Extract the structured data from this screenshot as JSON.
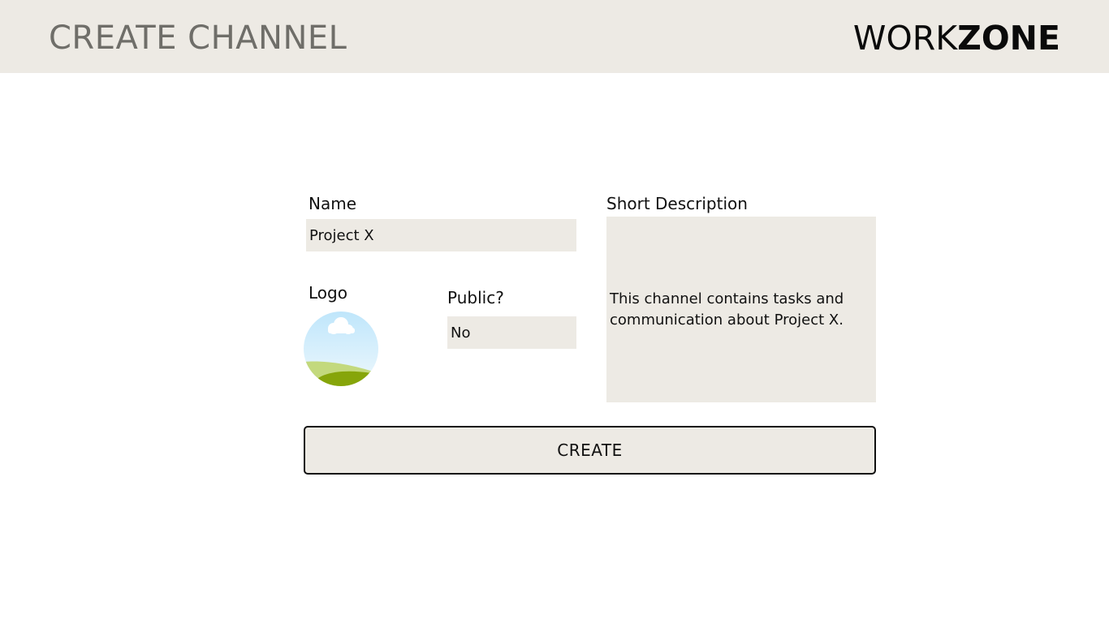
{
  "header": {
    "title": "CREATE CHANNEL",
    "brand_light": "WORK",
    "brand_bold": "ZONE"
  },
  "form": {
    "name_label": "Name",
    "name_value": "Project X",
    "logo_label": "Logo",
    "logo_image": "landscape-icon",
    "public_label": "Public?",
    "public_value": "No",
    "description_label": "Short Description",
    "description_value": "This channel contains tasks and communication about Project X.",
    "create_label": "CREATE"
  },
  "colors": {
    "header_bg": "#edeae4",
    "field_bg": "#edeae4",
    "title_text": "#6f6e69"
  }
}
